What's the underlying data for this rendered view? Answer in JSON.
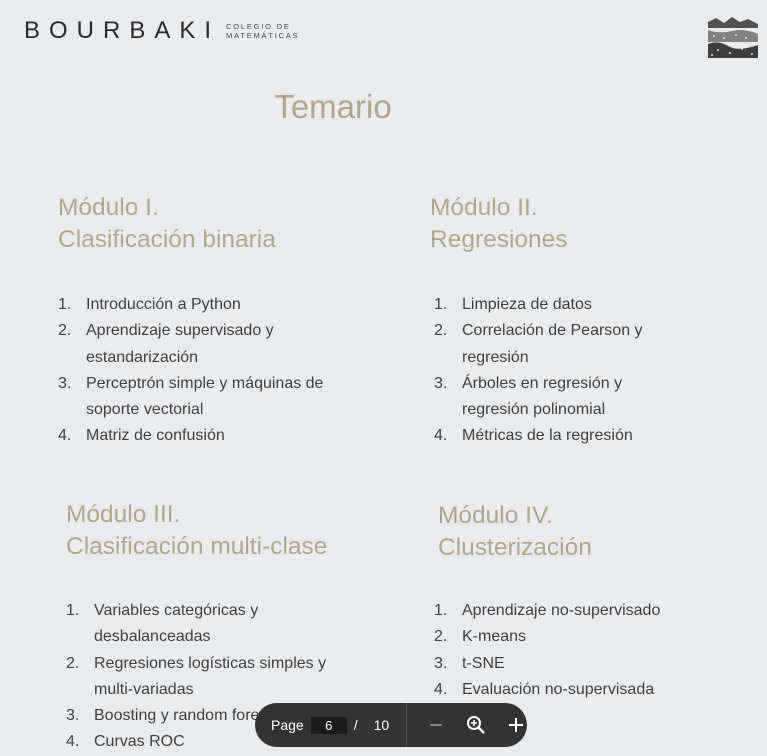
{
  "header": {
    "brand": "BOURBAKI",
    "brand_sub_line1": "COLEGIO DE",
    "brand_sub_line2": "MATEMÁTICAS",
    "logo_icon": "landscape-illustration-icon"
  },
  "title": "Temario",
  "modules": [
    {
      "heading_line1": "Módulo I.",
      "heading_line2": "Clasificación binaria",
      "items": [
        {
          "num": "1.",
          "text": "Introducción a Python"
        },
        {
          "num": "2.",
          "text": "Aprendizaje supervisado y estandarización"
        },
        {
          "num": "3.",
          "text": "Perceptrón simple y máquinas de soporte vectorial"
        },
        {
          "num": "4.",
          "text": "Matriz de confusión"
        }
      ]
    },
    {
      "heading_line1": "Módulo II.",
      "heading_line2": "Regresiones",
      "items": [
        {
          "num": "1.",
          "text": "Limpieza de datos"
        },
        {
          "num": "2.",
          "text": "Correlación de Pearson y regresión"
        },
        {
          "num": "3.",
          "text": "Árboles en regresión y regresión polinomial"
        },
        {
          "num": "4.",
          "text": "Métricas de la regresión"
        }
      ]
    },
    {
      "heading_line1": "Módulo III.",
      "heading_line2": "Clasificación multi-clase",
      "items": [
        {
          "num": "1.",
          "text": "Variables categóricas y desbalanceadas"
        },
        {
          "num": "2.",
          "text": "Regresiones logísticas simples y multi-variadas"
        },
        {
          "num": "3.",
          "text": "Boosting y random forests"
        },
        {
          "num": "4.",
          "text": "Curvas ROC"
        }
      ]
    },
    {
      "heading_line1": "Módulo IV.",
      "heading_line2": "Clusterización",
      "items": [
        {
          "num": "1.",
          "text": "Aprendizaje no-supervisado"
        },
        {
          "num": "2.",
          "text": "K-means"
        },
        {
          "num": "3.",
          "text": "t-SNE"
        },
        {
          "num": "4.",
          "text": "Evaluación no-supervisada"
        }
      ]
    }
  ],
  "pager": {
    "label": "Page",
    "current": "6",
    "separator": "/",
    "total": "10",
    "zoom_out_icon": "minus-icon",
    "zoom_icon": "zoom-in-icon",
    "zoom_in_icon": "plus-icon"
  }
}
